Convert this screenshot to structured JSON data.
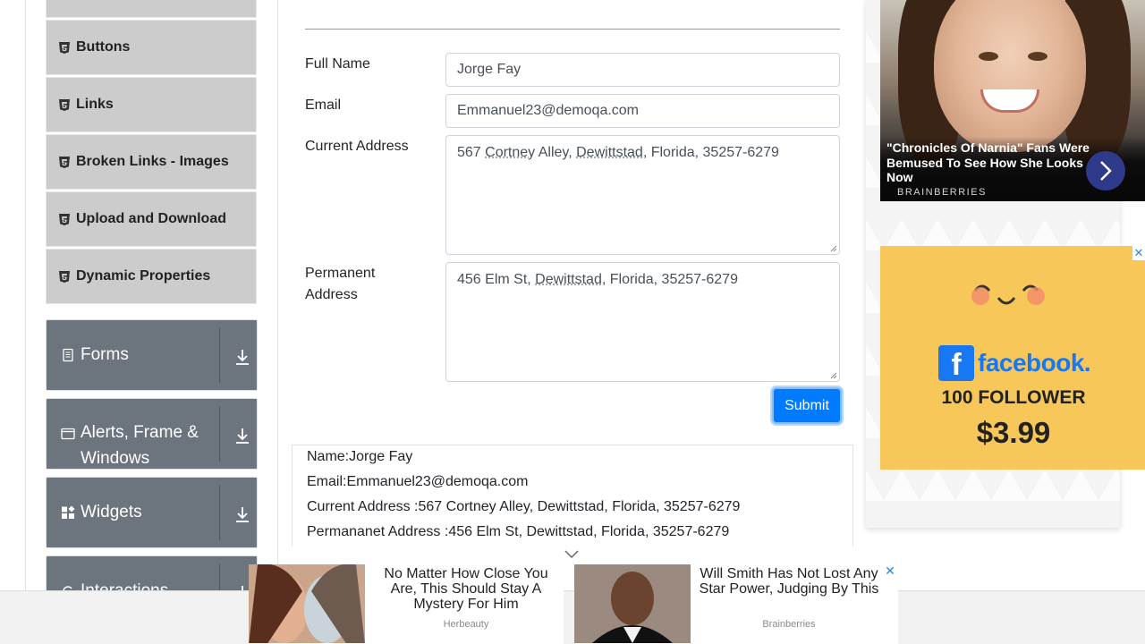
{
  "sidebar": {
    "sub_items": [
      {
        "label": ""
      },
      {
        "label": "Buttons"
      },
      {
        "label": "Links"
      },
      {
        "label": "Broken Links - Images"
      },
      {
        "label": "Upload and Download"
      },
      {
        "label": "Dynamic Properties"
      }
    ],
    "groups": [
      {
        "label": "Forms",
        "icon": "document-icon"
      },
      {
        "label": "Alerts, Frame & Windows",
        "icon": "window-icon"
      },
      {
        "label": "Widgets",
        "icon": "widgets-icon"
      },
      {
        "label": "Interactions",
        "icon": "interactions-icon"
      }
    ]
  },
  "form": {
    "full_name_label": "Full Name",
    "full_name_value": "Jorge Fay",
    "email_label": "Email",
    "email_value": "Emmanuel23@demoqa.com",
    "current_address_label": "Current Address",
    "current_address_parts": [
      "567 ",
      "Cortney",
      " Alley, ",
      "Dewittstad",
      ", Florida, 35257-6279"
    ],
    "permanent_address_label_1": "Permanent",
    "permanent_address_label_2": "Address",
    "permanent_address_parts": [
      "456 Elm St, ",
      "Dewittstad",
      ", Florida, 35257-6279"
    ],
    "submit_label": "Submit"
  },
  "output": {
    "name": "Name:Jorge Fay",
    "email": "Email:Emmanuel23@demoqa.com",
    "current_address": "Current Address :567 Cortney Alley, Dewittstad, Florida, 35257-6279",
    "permanent_address": "Permananet Address :456 Elm St, Dewittstad, Florida, 35257-6279"
  },
  "ads": {
    "top": {
      "title": "\"Chronicles Of Narnia\" Fans Were Bemused To See How She Looks Now",
      "brand": "BRAINBERRIES"
    },
    "facebook": {
      "logo_letter": "f",
      "logo_text": "facebook.",
      "followers": "100 FOLLOWER",
      "price": "$3.99"
    },
    "bottom": [
      {
        "text": "No Matter How Close You Are, This Should Stay A Mystery For Him",
        "source": "Herbeauty"
      },
      {
        "text": "Will Smith Has Not Lost Any Star Power, Judging By This",
        "source": "Brainberries"
      }
    ],
    "close_glyph": "✕"
  },
  "colors": {
    "primary": "#007bff",
    "group_bg": "#6c757d",
    "sub_item_bg": "#cccccc",
    "ad_yellow": "#f7c75a",
    "facebook_blue": "#1877f2"
  }
}
